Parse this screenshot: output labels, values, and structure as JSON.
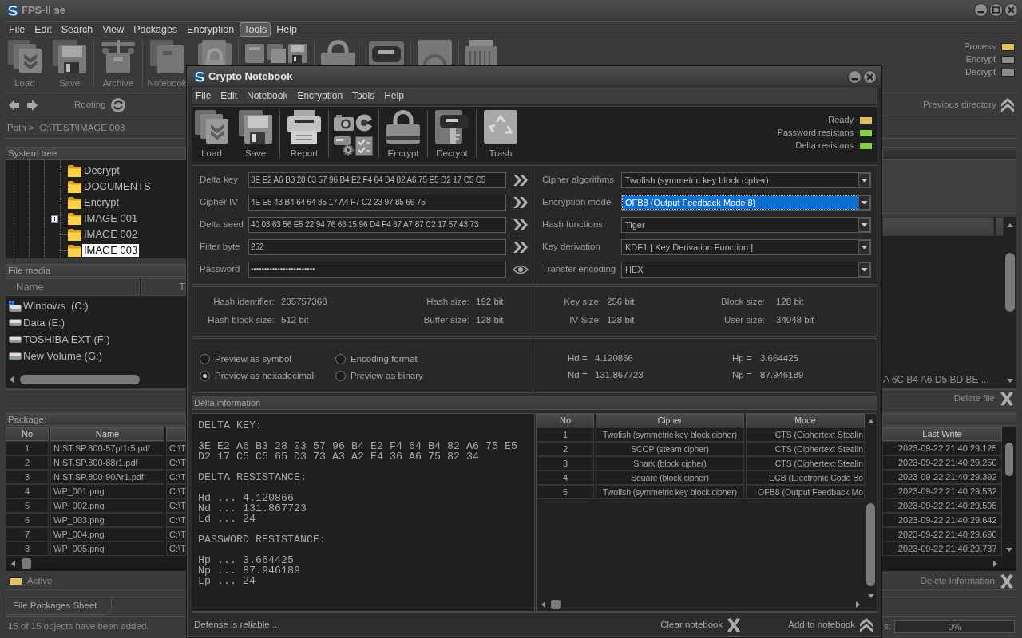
{
  "main_window": {
    "title": "FPS-II se",
    "menu": [
      {
        "label": "File",
        "selected": false
      },
      {
        "label": "Edit",
        "selected": false
      },
      {
        "label": "Search",
        "selected": false
      },
      {
        "label": "View",
        "selected": false
      },
      {
        "label": "Packages",
        "selected": false
      },
      {
        "label": "Encryption",
        "selected": false
      },
      {
        "label": "Tools",
        "selected": true
      },
      {
        "label": "Help",
        "selected": false
      }
    ],
    "toolbar": [
      {
        "kind": "buttons",
        "items": [
          {
            "label": "Load",
            "kind": "load"
          },
          {
            "label": "Save",
            "kind": "save"
          }
        ]
      },
      {
        "kind": "buttons",
        "items": [
          {
            "label": "Archive",
            "kind": "archive"
          }
        ]
      },
      {
        "kind": "buttons",
        "items": [
          {
            "label": "Notebook",
            "kind": "notebook"
          }
        ]
      }
    ],
    "indicators": [
      {
        "label": "Process",
        "color": "#e2c35a"
      },
      {
        "label": "Encrypt",
        "color": "#8c8c8c"
      },
      {
        "label": "Decrypt",
        "color": "#8c8c8c"
      }
    ],
    "navigation": {
      "rooting": "Rooting",
      "previous_directory": "Previous directory"
    },
    "path": {
      "label": "Path >",
      "value": "C:\\TEST\\IMAGE 003"
    },
    "system_tree": {
      "title": "System tree",
      "items": [
        {
          "label": "Decrypt",
          "expandable": false,
          "selected": false
        },
        {
          "label": "DOCUMENTS",
          "expandable": false,
          "selected": false
        },
        {
          "label": "Encrypt",
          "expandable": false,
          "selected": false
        },
        {
          "label": "IMAGE 001",
          "expandable": true,
          "selected": false
        },
        {
          "label": "IMAGE 002",
          "expandable": false,
          "selected": false
        },
        {
          "label": "IMAGE 003",
          "expandable": false,
          "selected": true
        }
      ]
    },
    "file_media": {
      "title": "File media",
      "columns": [
        "Name",
        "T"
      ],
      "drives": [
        {
          "label": "Windows  (C:)",
          "kind": "windows"
        },
        {
          "label": "Data (E:)",
          "kind": "drive"
        },
        {
          "label": "TOSHIBA EXT (F:)",
          "kind": "drive"
        },
        {
          "label": "New Volume (G:)",
          "kind": "drive"
        }
      ]
    },
    "side_text": "A 6C B4 A6 D5 BD BE ...",
    "delete_file": "Delete file",
    "package": {
      "title": "Package:",
      "columns": {
        "no": "No",
        "name": "Name",
        "last_write": "Last Write"
      },
      "rows": [
        {
          "no": "1",
          "name": "NIST.SP.800-57pt1r5.pdf",
          "path": "C:\\T",
          "last_write": "2023-09-22 21:40:29.125"
        },
        {
          "no": "2",
          "name": "NIST.SP.800-88r1.pdf",
          "path": "C:\\T",
          "last_write": "2023-09-22 21:40:29.250"
        },
        {
          "no": "3",
          "name": "NIST.SP.800-90Ar1.pdf",
          "path": "C:\\T",
          "last_write": "2023-09-22 21:40:29.392"
        },
        {
          "no": "4",
          "name": "WP_001.png",
          "path": "C:\\T",
          "last_write": "2023-09-22 21:40:29.532"
        },
        {
          "no": "5",
          "name": "WP_002.png",
          "path": "C:\\T",
          "last_write": "2023-09-22 21:40:29.595"
        },
        {
          "no": "6",
          "name": "WP_003.png",
          "path": "C:\\T",
          "last_write": "2023-09-22 21:40:29.642"
        },
        {
          "no": "7",
          "name": "WP_004.png",
          "path": "C:\\T",
          "last_write": "2023-09-22 21:40:29.690"
        },
        {
          "no": "8",
          "name": "WP_005.png",
          "path": "C:\\T",
          "last_write": "2023-09-22 21:40:29.737"
        }
      ]
    },
    "active": {
      "label": "Active",
      "color": "#e2c35a"
    },
    "delete_information": "Delete information",
    "tabs": [
      {
        "label": "File Packages Sheet",
        "selected": true
      }
    ],
    "status_bar": {
      "message": "15 of 15 objects have been added.",
      "progress_label": "s:",
      "progress": "0%"
    }
  },
  "notebook": {
    "title": "Crypto Notebook",
    "menu": [
      "File",
      "Edit",
      "Notebook",
      "Encryption",
      "Tools",
      "Help"
    ],
    "toolbar": [
      {
        "kind": "buttons",
        "items": [
          {
            "label": "Load",
            "kind": "load"
          },
          {
            "label": "Save",
            "kind": "save"
          }
        ]
      },
      {
        "kind": "buttons",
        "items": [
          {
            "label": "Report",
            "kind": "report"
          }
        ]
      },
      {
        "kind": "icon_grid"
      },
      {
        "kind": "buttons",
        "items": [
          {
            "label": "Encrypt",
            "kind": "encrypt"
          }
        ]
      },
      {
        "kind": "buttons",
        "items": [
          {
            "label": "Decrypt",
            "kind": "decrypt"
          }
        ]
      },
      {
        "kind": "buttons",
        "items": [
          {
            "label": "Trash",
            "kind": "trash"
          }
        ]
      }
    ],
    "indicators": [
      {
        "label": "Ready",
        "color": "#e2c35a"
      },
      {
        "label": "Password resistans",
        "color": "#7fd14e"
      },
      {
        "label": "Delta resistans",
        "color": "#7fd14e"
      }
    ],
    "fields": [
      {
        "label": "Delta key",
        "value": "3E E2 A6 B3 28 03 57 96 B4 E2 F4 64 B4 82 A6 75 E5 D2 17 C5 C5",
        "kind": "text"
      },
      {
        "label": "Cipher IV",
        "value": "4E E5 43 B4 64 64 85 17 A4 F7 C2 23 97 85 66 75",
        "kind": "text"
      },
      {
        "label": "Delta seed",
        "value": "40 03 63 56 E5 22 94 76 66 15 96 D4 F4 67 A7 87 C2 17 57 43 73",
        "kind": "text"
      },
      {
        "label": "Filter byte",
        "value": "252",
        "kind": "text"
      },
      {
        "label": "Password",
        "value": "••••••••••••••••••••••••",
        "kind": "password"
      }
    ],
    "selects": [
      {
        "label": "Cipher algorithms",
        "value": "Twofish (symmetric key block cipher)",
        "focused": false
      },
      {
        "label": "Encryption mode",
        "value": "OFB8 (Output Feedback Mode 8)",
        "focused": true
      },
      {
        "label": "Hash functions",
        "value": "Tiger",
        "focused": false
      },
      {
        "label": "Key derivation",
        "value": "KDF1 [ Key Derivation Function ]",
        "focused": false
      },
      {
        "label": "Transfer encoding",
        "value": "HEX",
        "focused": false
      }
    ],
    "info_left": [
      {
        "label": "Hash identifier:",
        "value": "235757368"
      },
      {
        "label": "Hash size:",
        "value": "192 bit"
      },
      {
        "label": "Hash block size:",
        "value": "512 bit"
      },
      {
        "label": "Buffer size:",
        "value": "128 bit"
      }
    ],
    "info_right": [
      {
        "label": "Key size:",
        "value": "256 bit"
      },
      {
        "label": "Block size:",
        "value": "128 bit"
      },
      {
        "label": "IV Size:",
        "value": "128 bit"
      },
      {
        "label": "User size:",
        "value": "34048 bit"
      }
    ],
    "preview_options": [
      {
        "label": "Preview as symbol",
        "selected": false
      },
      {
        "label": "Encoding format",
        "selected": false
      },
      {
        "label": "Preview as hexadecimal",
        "selected": true
      },
      {
        "label": "Preview as binary",
        "selected": false
      }
    ],
    "metrics": [
      {
        "label": "Hd =",
        "value": "4.120866"
      },
      {
        "label": "Hp =",
        "value": "3.664425"
      },
      {
        "label": "Nd =",
        "value": "131.867723"
      },
      {
        "label": "Np =",
        "value": "87.946189"
      }
    ],
    "delta_information": {
      "title": "Delta information",
      "sections": [
        {
          "heading": "DELTA KEY:",
          "lines": [
            "3E E2 A6 B3 28 03 57 96 B4 E2 F4 64 B4 82 A6 75 E5",
            "D2 17 C5 C5 65 D3 73 A3 A2 E4 36 A6 75 82 34"
          ]
        },
        {
          "heading": "DELTA RESISTANCE:",
          "lines": [
            "Hd ... 4.120866",
            "Nd ... 131.867723",
            "Ld ... 24"
          ]
        },
        {
          "heading": "PASSWORD RESISTANCE:",
          "lines": [
            "Hp ... 3.664425",
            "Np ... 87.946189",
            "Lp ... 24"
          ]
        }
      ]
    },
    "cipher_table": {
      "columns": [
        "No",
        "Cipher",
        "Mode"
      ],
      "rows": [
        {
          "no": "1",
          "cipher": "Twofish (symmetric key block cipher)",
          "mode": "CTS (Ciphertext Stealin"
        },
        {
          "no": "2",
          "cipher": "SCOP (steam cipher)",
          "mode": "CTS (Ciphertext Stealin"
        },
        {
          "no": "3",
          "cipher": "Shark (block cipher)",
          "mode": "CTS (Ciphertext Stealin"
        },
        {
          "no": "4",
          "cipher": "Square (block cipher)",
          "mode": "ECB (Electronic Code Bo"
        },
        {
          "no": "5",
          "cipher": "Twofish (symmetric key block cipher)",
          "mode": "OFB8 (Output Feedback Mo"
        }
      ]
    },
    "status": "Defense is reliable ...",
    "actions": [
      {
        "label": "Clear notebook",
        "kind": "clear"
      },
      {
        "label": "Add to notebook",
        "kind": "add"
      }
    ]
  }
}
